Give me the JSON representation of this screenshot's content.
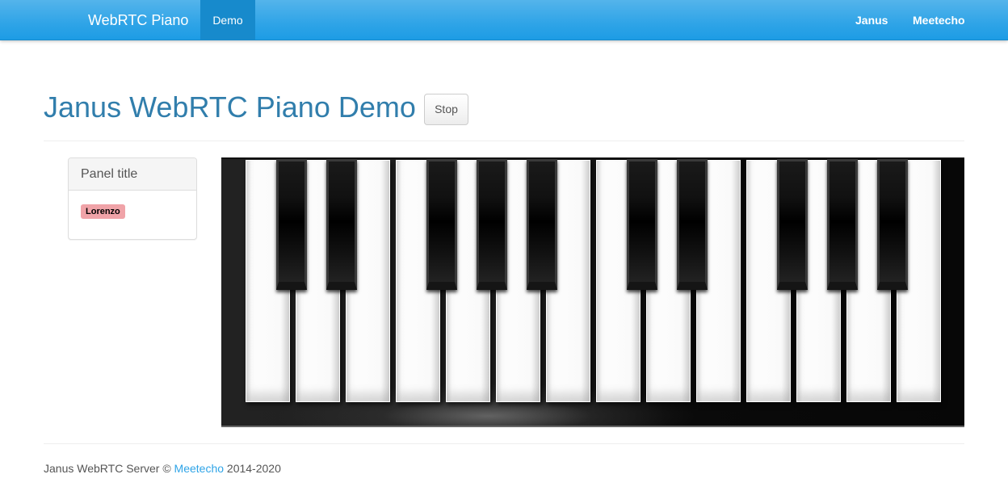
{
  "navbar": {
    "brand": "WebRTC Piano",
    "items": [
      {
        "label": "Demo",
        "active": true
      }
    ],
    "right_items": [
      {
        "label": "Janus"
      },
      {
        "label": "Meetecho"
      }
    ],
    "accent_color": "#2fa4e7"
  },
  "header": {
    "title": "Janus WebRTC Piano Demo",
    "stop_button": "Stop"
  },
  "panel": {
    "title": "Panel title",
    "participants": [
      {
        "name": "Lorenzo",
        "color": "#f0a3a8"
      }
    ]
  },
  "piano": {
    "octaves": 2,
    "white_keys": [
      "C",
      "D",
      "E",
      "F",
      "G",
      "A",
      "B",
      "C",
      "D",
      "E",
      "F",
      "G",
      "A",
      "B"
    ],
    "black_keys": [
      "C#",
      "D#",
      "F#",
      "G#",
      "A#",
      "C#",
      "D#",
      "F#",
      "G#",
      "A#"
    ]
  },
  "footer": {
    "prefix": "Janus WebRTC Server ©",
    "link": "Meetecho",
    "suffix": "2014-2020"
  }
}
